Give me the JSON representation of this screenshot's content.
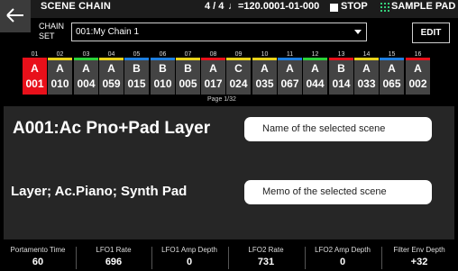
{
  "header": {
    "title": "SCENE CHAIN",
    "time_signature": "4 / 4",
    "tempo": "♩=120.00",
    "position": "001-01-000",
    "transport": "STOP",
    "mode": "SAMPLE PAD"
  },
  "chain_set": {
    "label_line1": "CHAIN",
    "label_line2": "SET",
    "value": "001:My Chain 1"
  },
  "edit_label": "EDIT",
  "steps": [
    {
      "n": "01",
      "bank": "A",
      "num": "001",
      "color": "#e8101a",
      "selected": true
    },
    {
      "n": "02",
      "bank": "A",
      "num": "010",
      "color": "#e8d21a"
    },
    {
      "n": "03",
      "bank": "A",
      "num": "004",
      "color": "#2bd13a"
    },
    {
      "n": "04",
      "bank": "A",
      "num": "059",
      "color": "#e8d21a"
    },
    {
      "n": "05",
      "bank": "B",
      "num": "015",
      "color": "#1e7fe0"
    },
    {
      "n": "06",
      "bank": "B",
      "num": "010",
      "color": "#1e7fe0"
    },
    {
      "n": "07",
      "bank": "B",
      "num": "005",
      "color": "#e8d21a"
    },
    {
      "n": "08",
      "bank": "A",
      "num": "017",
      "color": "#e8101a"
    },
    {
      "n": "09",
      "bank": "C",
      "num": "024",
      "color": "#e8d21a"
    },
    {
      "n": "10",
      "bank": "A",
      "num": "035",
      "color": "#e8d21a"
    },
    {
      "n": "11",
      "bank": "A",
      "num": "067",
      "color": "#1e7fe0"
    },
    {
      "n": "12",
      "bank": "A",
      "num": "044",
      "color": "#2bd13a"
    },
    {
      "n": "13",
      "bank": "B",
      "num": "014",
      "color": "#e8101a"
    },
    {
      "n": "14",
      "bank": "A",
      "num": "033",
      "color": "#e8d21a"
    },
    {
      "n": "15",
      "bank": "A",
      "num": "065",
      "color": "#1e7fe0"
    },
    {
      "n": "16",
      "bank": "A",
      "num": "002",
      "color": "#e8101a"
    }
  ],
  "page_indicator": "Page  1/32",
  "scene": {
    "name": "A001:Ac Pno+Pad Layer",
    "memo": "Layer;  Ac.Piano;  Synth Pad",
    "name_button": "Name of the selected scene",
    "memo_button": "Memo of the selected scene"
  },
  "params": [
    {
      "label": "Portamento Time",
      "value": "60"
    },
    {
      "label": "LFO1 Rate",
      "value": "696"
    },
    {
      "label": "LFO1 Amp Depth",
      "value": "0"
    },
    {
      "label": "LFO2 Rate",
      "value": "731"
    },
    {
      "label": "LFO2 Amp Depth",
      "value": "0"
    },
    {
      "label": "Filter Env Depth",
      "value": "+32"
    }
  ]
}
